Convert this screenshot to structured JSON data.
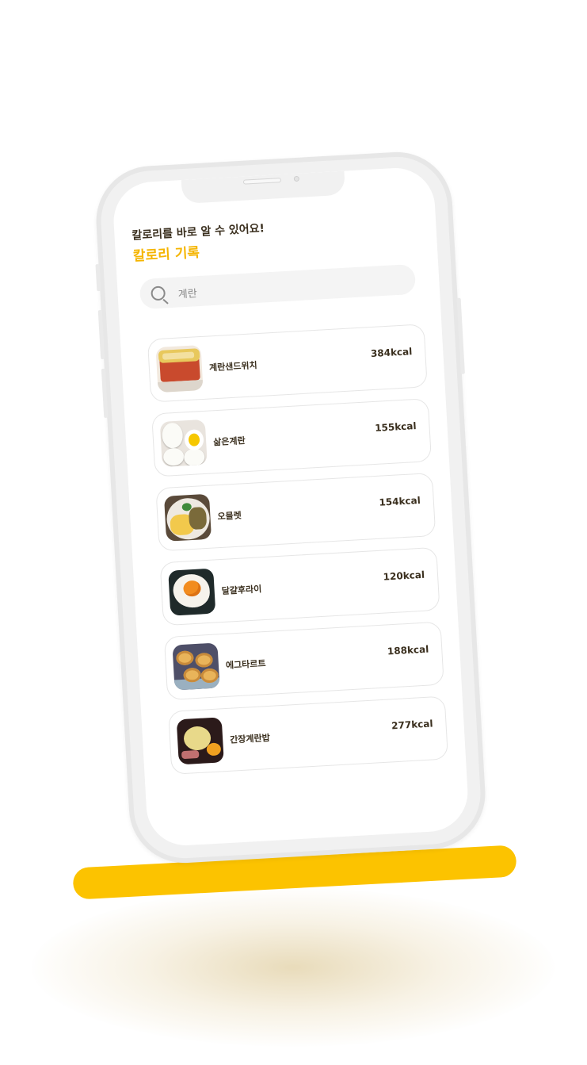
{
  "header": {
    "subtitle": "칼로리를 바로 알 수 있어요!",
    "title": "칼로리 기록"
  },
  "search": {
    "value": "계란",
    "icon": "search-icon"
  },
  "foods": [
    {
      "name": "계란샌드위치",
      "kcal": "384kcal",
      "image": "egg-sandwich-photo"
    },
    {
      "name": "삶은계란",
      "kcal": "155kcal",
      "image": "boiled-egg-photo"
    },
    {
      "name": "오믈렛",
      "kcal": "154kcal",
      "image": "omelet-photo"
    },
    {
      "name": "달걀후라이",
      "kcal": "120kcal",
      "image": "fried-egg-photo"
    },
    {
      "name": "에그타르트",
      "kcal": "188kcal",
      "image": "egg-tart-photo"
    },
    {
      "name": "간장계란밥",
      "kcal": "277kcal",
      "image": "soy-egg-rice-photo"
    }
  ],
  "colors": {
    "accent": "#f5b500",
    "stand": "#fcc300",
    "text": "#3a2f1e"
  }
}
